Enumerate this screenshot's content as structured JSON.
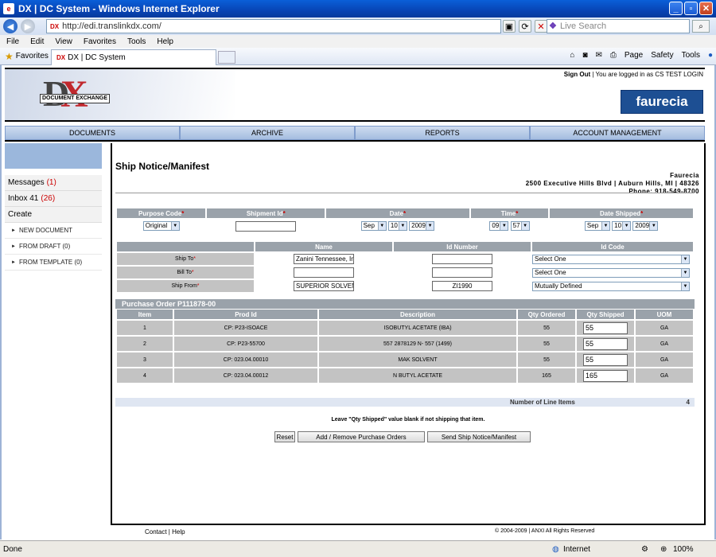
{
  "window": {
    "title": "DX | DC System - Windows Internet Explorer"
  },
  "address": {
    "url": "http://edi.translinkdx.com/",
    "favicon": "DX",
    "search_placeholder": "Live Search"
  },
  "menu": [
    "File",
    "Edit",
    "View",
    "Favorites",
    "Tools",
    "Help"
  ],
  "favbar": {
    "favorites": "Favorites",
    "tab_title": "DX | DC System",
    "page": "Page",
    "safety": "Safety",
    "tools": "Tools"
  },
  "header": {
    "sign_out": "Sign Out",
    "logged_in": " | You are logged in as CS TEST LOGIN",
    "brand": "faurecia",
    "logo_text": "DOCUMENT EXCHANGE"
  },
  "nav": [
    "DOCUMENTS",
    "ARCHIVE",
    "REPORTS",
    "ACCOUNT MANAGEMENT"
  ],
  "sidebar": {
    "messages": "Messages",
    "messages_count": "(1)",
    "inbox": "Inbox 41",
    "inbox_count": "(26)",
    "create": "Create",
    "items": [
      "NEW DOCUMENT",
      "FROM DRAFT (0)",
      "FROM TEMPLATE (0)"
    ]
  },
  "page": {
    "title": "Ship Notice/Manifest",
    "company": "Faurecia",
    "address": "2500 Executive Hills Blvd | Auburn Hills, MI | 48326",
    "phone": "Phone: 918-549-8700"
  },
  "form1": {
    "headers": [
      "Purpose Code",
      "Shipment Id",
      "Date",
      "Time",
      "Date Shipped"
    ],
    "purpose_code": "Original",
    "shipment_id": "",
    "date": {
      "month": "Sep",
      "day": "10",
      "year": "2009"
    },
    "time": {
      "hour": "09",
      "minute": "57"
    },
    "date_shipped": {
      "month": "Sep",
      "day": "10",
      "year": "2009"
    }
  },
  "form2": {
    "headers": [
      "",
      "Name",
      "Id Number",
      "Id Code"
    ],
    "rows": [
      {
        "label": "Ship To",
        "name": "Zanini Tennessee, Inc",
        "id_number": "",
        "id_code": "Select One"
      },
      {
        "label": "Bill To",
        "name": "",
        "id_number": "",
        "id_code": "Select One"
      },
      {
        "label": "Ship From",
        "name": "SUPERIOR SOLVENT",
        "id_number": "ZI1990",
        "id_code": "Mutually Defined"
      }
    ]
  },
  "po": {
    "title": "Purchase Order P111878-00",
    "headers": [
      "Item",
      "Prod Id",
      "Description",
      "Qty Ordered",
      "Qty Shipped",
      "UOM"
    ],
    "rows": [
      {
        "item": "1",
        "prod": "CP: P23-ISOACE",
        "desc": "ISOBUTYL ACETATE (IBA)",
        "ordered": "55",
        "shipped": "55",
        "uom": "GA"
      },
      {
        "item": "2",
        "prod": "CP: P23-55700",
        "desc": "557 2878129 N- 557 (1499)",
        "ordered": "55",
        "shipped": "55",
        "uom": "GA"
      },
      {
        "item": "3",
        "prod": "CP: 023.04.00010",
        "desc": "MAK SOLVENT",
        "ordered": "55",
        "shipped": "55",
        "uom": "GA"
      },
      {
        "item": "4",
        "prod": "CP: 023.04.00012",
        "desc": "N BUTYL ACETATE",
        "ordered": "165",
        "shipped": "165",
        "uom": "GA"
      }
    ],
    "num_items_label": "Number of Line Items",
    "num_items": "4"
  },
  "hint": "Leave \"Qty Shipped\" value blank if not shipping that item.",
  "buttons": {
    "reset": "Reset",
    "add_remove": "Add / Remove Purchase Orders",
    "send": "Send Ship Notice/Manifest"
  },
  "footer": {
    "links": "Contact | Help",
    "copyright": "© 2004-2009 | ANXI All Rights Reserved"
  },
  "status": {
    "left": "Done",
    "zone": "Internet",
    "zoom": "100%"
  }
}
